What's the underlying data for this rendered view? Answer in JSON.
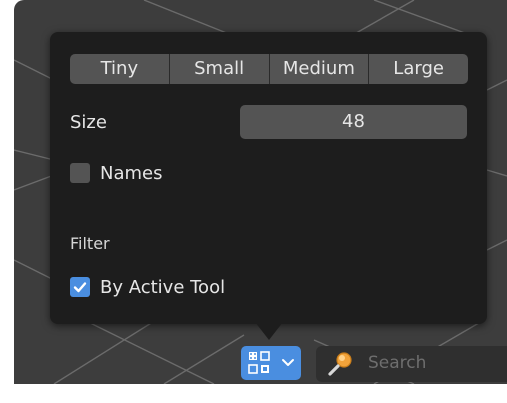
{
  "popup": {
    "size_buttons": [
      {
        "label": "Tiny"
      },
      {
        "label": "Small"
      },
      {
        "label": "Medium"
      },
      {
        "label": "Large"
      }
    ],
    "size_label": "Size",
    "size_value": "48",
    "names_label": "Names",
    "names_checked": false,
    "filter_heading": "Filter",
    "by_active_tool_label": "By Active Tool",
    "by_active_tool_checked": true
  },
  "toolbar": {
    "display_button_icon": "grid-view-icon",
    "dropdown_icon": "chevron-down-icon",
    "search_icon": "magnifier-icon",
    "search_placeholder": "Search"
  },
  "colors": {
    "popup_bg": "#1d1d1d",
    "widget_bg": "#545454",
    "accent": "#4a8ee0",
    "viewport_bg": "#3d3d3d",
    "text": "#e6e6e6"
  }
}
